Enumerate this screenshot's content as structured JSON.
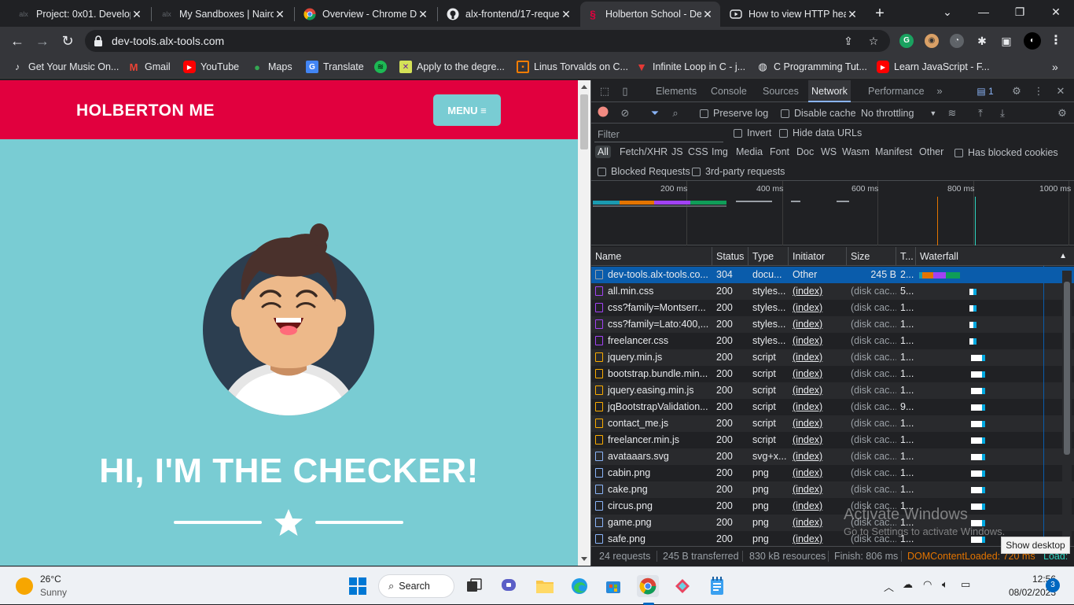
{
  "tabs": [
    {
      "title": "Project: 0x01. Develop",
      "icon": "alx-favicon-icon"
    },
    {
      "title": "My Sandboxes | Nairol",
      "icon": "alx-favicon-icon"
    },
    {
      "title": "Overview - Chrome De",
      "icon": "chrome-favicon-icon"
    },
    {
      "title": "alx-frontend/17-reque",
      "icon": "github-favicon-icon"
    },
    {
      "title": "Holberton School - De",
      "icon": "holberton-favicon-icon",
      "active": true
    },
    {
      "title": "How to view HTTP hea",
      "icon": "youtube-favicon-icon"
    }
  ],
  "toolbar": {
    "url": "dev-tools.alx-tools.com"
  },
  "bookmarks": [
    {
      "label": "Get Your Music On...",
      "icon": "music-icon"
    },
    {
      "label": "Gmail",
      "icon": "gmail-icon"
    },
    {
      "label": "YouTube",
      "icon": "youtube-icon"
    },
    {
      "label": "Maps",
      "icon": "maps-icon"
    },
    {
      "label": "Translate",
      "icon": "translate-icon"
    },
    {
      "label": "",
      "icon": "spotify-icon"
    },
    {
      "label": "Apply to the degre...",
      "icon": "apply-icon"
    },
    {
      "label": "Linus Torvalds on C...",
      "icon": "linus-icon"
    },
    {
      "label": "Infinite Loop in C - j...",
      "icon": "infinite-icon"
    },
    {
      "label": "C Programming Tut...",
      "icon": "cprog-icon"
    },
    {
      "label": "Learn JavaScript - F...",
      "icon": "youtube-icon"
    }
  ],
  "page": {
    "brand": "HOLBERTON ME",
    "menu_label": "MENU ≡",
    "headline": "HI, I'M THE CHECKER!"
  },
  "devtools": {
    "tabs": [
      "Elements",
      "Console",
      "Sources",
      "Network",
      "Performance"
    ],
    "active_tab": "Network",
    "issues_count": "1",
    "preserve_log": "Preserve log",
    "disable_cache": "Disable cache",
    "throttling": "No throttling",
    "filter_placeholder": "Filter",
    "invert": "Invert",
    "hide_data_urls": "Hide data URLs",
    "types": [
      "All",
      "Fetch/XHR",
      "JS",
      "CSS",
      "Img",
      "Media",
      "Font",
      "Doc",
      "WS",
      "Wasm",
      "Manifest",
      "Other"
    ],
    "has_blocked_cookies": "Has blocked cookies",
    "blocked_requests": "Blocked Requests",
    "third_party": "3rd-party requests",
    "timeline_ticks": [
      "200 ms",
      "400 ms",
      "600 ms",
      "800 ms",
      "1000 ms"
    ],
    "columns": [
      "Name",
      "Status",
      "Type",
      "Initiator",
      "Size",
      "T...",
      "Waterfall"
    ],
    "rows": [
      {
        "name": "dev-tools.alx-tools.co...",
        "status": "304",
        "type": "docu...",
        "initiator": "Other",
        "size": "245 B",
        "time": "2...",
        "kind": "doc"
      },
      {
        "name": "all.min.css",
        "status": "200",
        "type": "styles...",
        "initiator": "(index)",
        "size": "(disk cac...",
        "time": "5...",
        "kind": "css"
      },
      {
        "name": "css?family=Montserr...",
        "status": "200",
        "type": "styles...",
        "initiator": "(index)",
        "size": "(disk cac...",
        "time": "1...",
        "kind": "css"
      },
      {
        "name": "css?family=Lato:400,...",
        "status": "200",
        "type": "styles...",
        "initiator": "(index)",
        "size": "(disk cac...",
        "time": "1...",
        "kind": "css"
      },
      {
        "name": "freelancer.css",
        "status": "200",
        "type": "styles...",
        "initiator": "(index)",
        "size": "(disk cac...",
        "time": "1...",
        "kind": "css"
      },
      {
        "name": "jquery.min.js",
        "status": "200",
        "type": "script",
        "initiator": "(index)",
        "size": "(disk cac...",
        "time": "1...",
        "kind": "js"
      },
      {
        "name": "bootstrap.bundle.min...",
        "status": "200",
        "type": "script",
        "initiator": "(index)",
        "size": "(disk cac...",
        "time": "1...",
        "kind": "js"
      },
      {
        "name": "jquery.easing.min.js",
        "status": "200",
        "type": "script",
        "initiator": "(index)",
        "size": "(disk cac...",
        "time": "1...",
        "kind": "js"
      },
      {
        "name": "jqBootstrapValidation...",
        "status": "200",
        "type": "script",
        "initiator": "(index)",
        "size": "(disk cac...",
        "time": "9...",
        "kind": "js"
      },
      {
        "name": "contact_me.js",
        "status": "200",
        "type": "script",
        "initiator": "(index)",
        "size": "(disk cac...",
        "time": "1...",
        "kind": "js"
      },
      {
        "name": "freelancer.min.js",
        "status": "200",
        "type": "script",
        "initiator": "(index)",
        "size": "(disk cac...",
        "time": "1...",
        "kind": "js"
      },
      {
        "name": "avataaars.svg",
        "status": "200",
        "type": "svg+x...",
        "initiator": "(index)",
        "size": "(disk cac...",
        "time": "1...",
        "kind": "img"
      },
      {
        "name": "cabin.png",
        "status": "200",
        "type": "png",
        "initiator": "(index)",
        "size": "(disk cac...",
        "time": "1...",
        "kind": "img"
      },
      {
        "name": "cake.png",
        "status": "200",
        "type": "png",
        "initiator": "(index)",
        "size": "(disk cac...",
        "time": "1...",
        "kind": "img"
      },
      {
        "name": "circus.png",
        "status": "200",
        "type": "png",
        "initiator": "(index)",
        "size": "(disk cac...",
        "time": "1...",
        "kind": "img"
      },
      {
        "name": "game.png",
        "status": "200",
        "type": "png",
        "initiator": "(index)",
        "size": "(disk cac...",
        "time": "1...",
        "kind": "img"
      },
      {
        "name": "safe.png",
        "status": "200",
        "type": "png",
        "initiator": "(index)",
        "size": "(disk cac...",
        "time": "1...",
        "kind": "img"
      }
    ],
    "status": {
      "requests": "24 requests",
      "transferred": "245 B transferred",
      "resources": "830 kB resources",
      "finish": "Finish: 806 ms",
      "dcl": "DOMContentLoaded: 720 ms",
      "load": "Load:"
    }
  },
  "watermark": {
    "title": "Activate Windows",
    "subtitle": "Go to Settings to activate Windows."
  },
  "tooltip": "Show desktop",
  "taskbar": {
    "temp": "26°C",
    "weather": "Sunny",
    "search": "Search",
    "time": "12:56",
    "date": "08/02/2023",
    "notifications": "3"
  },
  "colors": {
    "brand_red": "#e1003e",
    "teal": "#79ccd3",
    "select_blue": "#0a5cab",
    "record_red": "#f28b82"
  }
}
